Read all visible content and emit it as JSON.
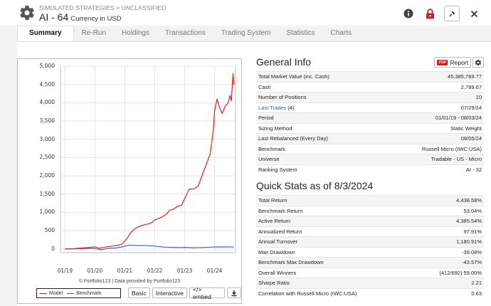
{
  "header": {
    "breadcrumb": "SIMULATED STRATEGIES > UNCLASSIFIED",
    "title": "AI - 64",
    "subtitle": "Currency in USD"
  },
  "tabs": [
    {
      "label": "Summary",
      "active": true
    },
    {
      "label": "Re-Run"
    },
    {
      "label": "Holdings"
    },
    {
      "label": "Transactions"
    },
    {
      "label": "Trading System"
    },
    {
      "label": "Statistics"
    },
    {
      "label": "Charts"
    }
  ],
  "general_info": {
    "title": "General Info",
    "report_label": "Report",
    "pdf_label": "PDF",
    "rows": [
      {
        "k": "Total Market Value (inc. Cash)",
        "v": "45,385,769.77"
      },
      {
        "k": "Cash",
        "v": "2,789.67"
      },
      {
        "k": "Number of Positions",
        "v": "10",
        "k_link": true,
        "v_link": true
      },
      {
        "k": "Last Trades",
        "k_extra": "(4)",
        "v": "07/29/24",
        "k_link": true,
        "v_link": true
      },
      {
        "k": "Period",
        "v": "01/01/19 - 08/03/24"
      },
      {
        "k": "Sizing Method",
        "v": "Static Weight"
      },
      {
        "k": "Last Rebalanced (Every Day)",
        "v": "08/05/24"
      },
      {
        "k": "Benchmark",
        "v": "Russell Micro (IWC:USA)"
      },
      {
        "k": "Universe",
        "v": "Tradable - US - Micro",
        "v_link": true
      },
      {
        "k": "Ranking System",
        "v": "AI - 32",
        "v_link": true
      }
    ]
  },
  "quick_stats": {
    "title": "Quick Stats as of 8/3/2024",
    "rows": [
      {
        "k": "Total Return",
        "v": "4,438.58%"
      },
      {
        "k": "Benchmark Return",
        "v": "53.04%"
      },
      {
        "k": "Active Return",
        "v": "4,385.54%"
      },
      {
        "k": "Annualized Return",
        "v": "97.91%"
      },
      {
        "k": "Annual Turnover",
        "v": "1,180.91%"
      },
      {
        "k": "Max Drawdown",
        "v": "-39.08%",
        "neg": true
      },
      {
        "k": "Benchmark Max Drawdown",
        "v": "-43.57%",
        "neg": true
      },
      {
        "k": "Overall Winners",
        "v": "(412/692) 59.00%"
      },
      {
        "k": "Sharpe Ratio",
        "v": "2.21"
      },
      {
        "k": "Correlation with Russell Micro (IWC:USA)",
        "v": "0.63"
      }
    ]
  },
  "chart": {
    "credit": "© Portfolio123 | Data provided by Portfolio123",
    "buttons": [
      "Basic",
      "Interactive",
      "</> embed"
    ],
    "colors": {
      "model": "#ee1c1c",
      "benchmark": "#3a5fd0"
    }
  },
  "chart_data": {
    "type": "line",
    "ylim": [
      -100,
      5000
    ],
    "yticks": [
      "5,000",
      "4,500",
      "4,000",
      "3,500",
      "3,000",
      "2,500",
      "2,000",
      "1,500",
      "1,000",
      "500",
      "0"
    ],
    "xticks": [
      "01/19",
      "01/20",
      "01/21",
      "01/22",
      "01/23",
      "01/24"
    ],
    "series": [
      {
        "name": "Model",
        "points": [
          [
            2019.0,
            0
          ],
          [
            2019.3,
            10
          ],
          [
            2019.6,
            30
          ],
          [
            2019.9,
            50
          ],
          [
            2020.0,
            55
          ],
          [
            2020.15,
            20
          ],
          [
            2020.25,
            40
          ],
          [
            2020.5,
            70
          ],
          [
            2020.75,
            100
          ],
          [
            2020.9,
            130
          ],
          [
            2021.0,
            220
          ],
          [
            2021.1,
            320
          ],
          [
            2021.2,
            450
          ],
          [
            2021.35,
            560
          ],
          [
            2021.5,
            620
          ],
          [
            2021.6,
            650
          ],
          [
            2021.75,
            680
          ],
          [
            2021.9,
            720
          ],
          [
            2022.0,
            800
          ],
          [
            2022.1,
            820
          ],
          [
            2022.25,
            880
          ],
          [
            2022.4,
            960
          ],
          [
            2022.5,
            1060
          ],
          [
            2022.6,
            1080
          ],
          [
            2022.75,
            1160
          ],
          [
            2022.9,
            1200
          ],
          [
            2023.0,
            1380
          ],
          [
            2023.15,
            1640
          ],
          [
            2023.3,
            1640
          ],
          [
            2023.45,
            1720
          ],
          [
            2023.6,
            2050
          ],
          [
            2023.75,
            2380
          ],
          [
            2023.85,
            2600
          ],
          [
            2023.95,
            3200
          ],
          [
            2024.0,
            3780
          ],
          [
            2024.08,
            4100
          ],
          [
            2024.15,
            3900
          ],
          [
            2024.25,
            3700
          ],
          [
            2024.35,
            3900
          ],
          [
            2024.45,
            4000
          ],
          [
            2024.52,
            4200
          ],
          [
            2024.56,
            4050
          ],
          [
            2024.6,
            4600
          ],
          [
            2024.62,
            4800
          ],
          [
            2024.64,
            4500
          ]
        ]
      },
      {
        "name": "Benchmark",
        "points": [
          [
            2019.0,
            0
          ],
          [
            2019.3,
            5
          ],
          [
            2019.6,
            10
          ],
          [
            2019.9,
            15
          ],
          [
            2020.0,
            10
          ],
          [
            2020.2,
            -20
          ],
          [
            2020.4,
            10
          ],
          [
            2020.7,
            30
          ],
          [
            2020.9,
            55
          ],
          [
            2021.0,
            80
          ],
          [
            2021.15,
            100
          ],
          [
            2021.4,
            95
          ],
          [
            2021.75,
            90
          ],
          [
            2022.0,
            80
          ],
          [
            2022.3,
            50
          ],
          [
            2022.6,
            45
          ],
          [
            2022.9,
            40
          ],
          [
            2023.0,
            45
          ],
          [
            2023.3,
            35
          ],
          [
            2023.6,
            40
          ],
          [
            2023.9,
            50
          ],
          [
            2024.0,
            55
          ],
          [
            2024.3,
            55
          ],
          [
            2024.5,
            60
          ],
          [
            2024.64,
            50
          ]
        ]
      }
    ]
  }
}
